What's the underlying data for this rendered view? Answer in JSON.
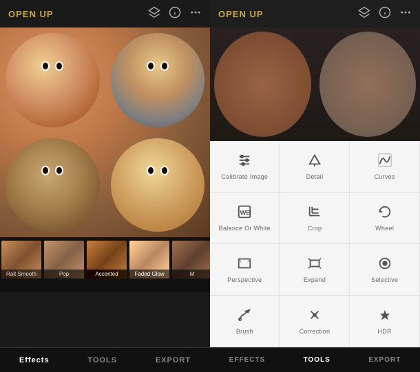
{
  "app": {
    "title": "OPEN UP"
  },
  "left": {
    "title": "OPEN UP",
    "icons": [
      "layers-icon",
      "info-icon",
      "more-icon"
    ],
    "thumbnails": [
      {
        "label": "Rait Smooth"
      },
      {
        "label": "Pop"
      },
      {
        "label": "Accented"
      },
      {
        "label": "Faded Glow"
      },
      {
        "label": "M"
      }
    ],
    "tabs": [
      {
        "label": "Effects",
        "active": true
      },
      {
        "label": "TOOLS",
        "active": false
      },
      {
        "label": "EXPORT",
        "active": false
      }
    ]
  },
  "right": {
    "title": "OPEN UP",
    "tabs": [
      {
        "label": "EFFECTS",
        "active": false
      },
      {
        "label": "TOOLS",
        "active": true
      },
      {
        "label": "EXPORT",
        "active": false
      }
    ],
    "tools": [
      {
        "label": "Calibrate Image",
        "icon": "sliders"
      },
      {
        "label": "Detail",
        "icon": "triangle-down"
      },
      {
        "label": "Curves",
        "icon": "curve"
      },
      {
        "label": "Balance Or White",
        "icon": "wb"
      },
      {
        "label": "Crop",
        "icon": "crop"
      },
      {
        "label": "Wheel",
        "icon": "rotate"
      },
      {
        "label": "Perspective",
        "icon": "perspective"
      },
      {
        "label": "Expand",
        "icon": "expand"
      },
      {
        "label": "Selective",
        "icon": "selective"
      },
      {
        "label": "Brush",
        "icon": "brush"
      },
      {
        "label": "Correction",
        "icon": "correction"
      },
      {
        "label": "HDR",
        "icon": "hdr"
      }
    ]
  }
}
